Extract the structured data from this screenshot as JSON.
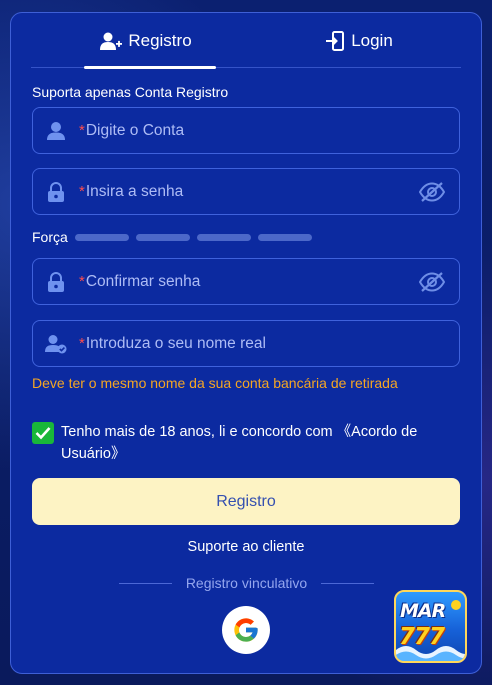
{
  "tabs": {
    "registro": "Registro",
    "login": "Login"
  },
  "form": {
    "hint": "Suporta apenas Conta Registro",
    "required_mark": "*",
    "account_placeholder": "Digite o Conta",
    "password_placeholder": "Insira a senha",
    "strength_label": "Força",
    "strength_level": 0,
    "confirm_placeholder": "Confirmar senha",
    "realname_placeholder": "Introduza o seu nome real",
    "realname_warning": "Deve ter o mesmo nome da sua conta bancária de retirada",
    "agreement_checked": true,
    "agreement_text": "Tenho mais de 18 anos, li e concordo com ",
    "agreement_link": "《Acordo de Usuário》",
    "submit_label": "Registro"
  },
  "footer": {
    "support_label": "Suporte ao cliente",
    "divider_label": "Registro vinculativo",
    "social": [
      "google-icon"
    ]
  },
  "logo": {
    "line1": "MAR",
    "line2": "777"
  },
  "colors": {
    "panel": "#0c2aa0",
    "border": "#3f62dc",
    "warning": "#f5a623",
    "required": "#ff4d4d",
    "submit_bg": "#fdf3c4",
    "checkbox": "#19b73a"
  }
}
